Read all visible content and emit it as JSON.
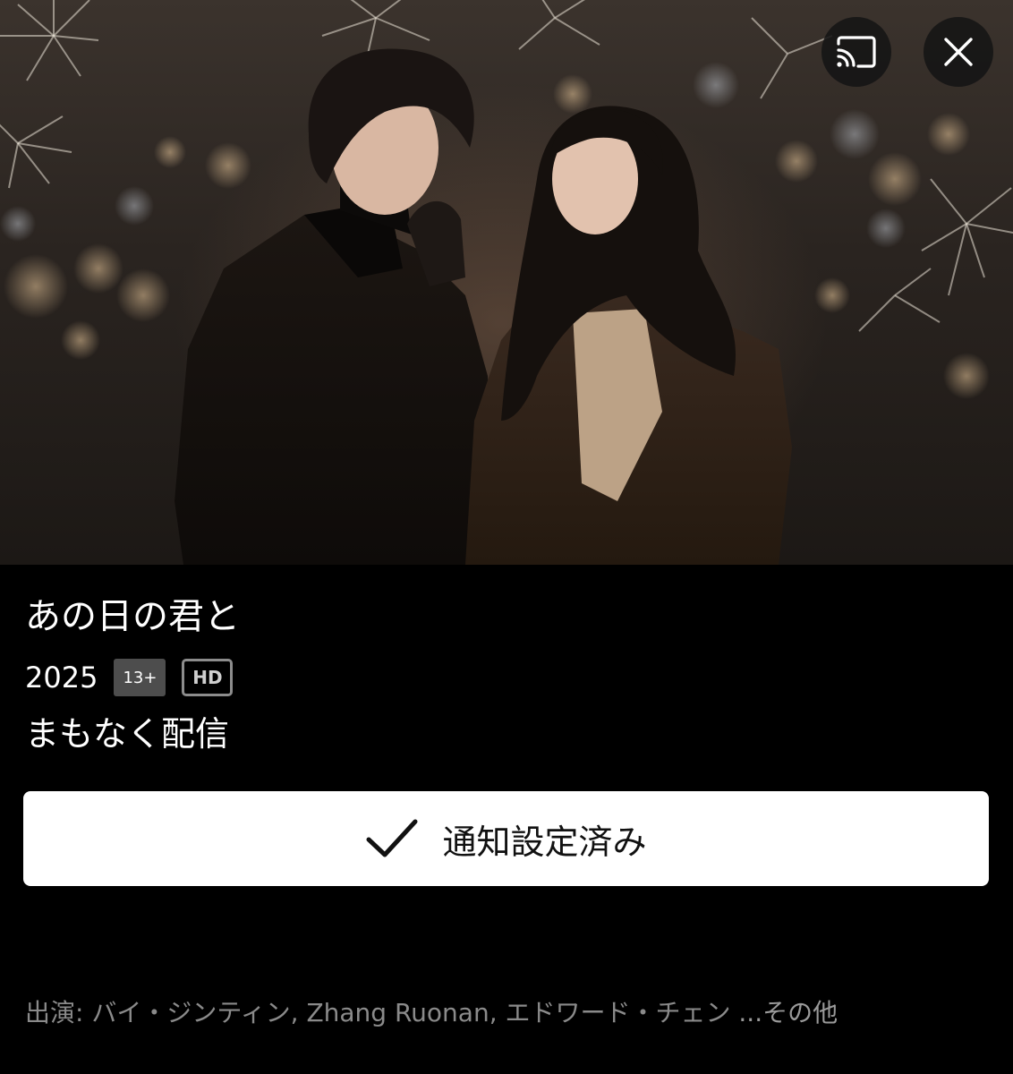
{
  "hero": {
    "image_alt": "poster-couple-fireworks-night"
  },
  "controls": {
    "cast_icon": "cast-icon",
    "close_icon": "close-icon"
  },
  "title": "あの日の君と",
  "meta": {
    "year": "2025",
    "rating": "13+",
    "quality": "HD"
  },
  "availability": "まもなく配信",
  "notify_button": {
    "label": "通知設定済み",
    "icon": "check-icon"
  },
  "cast": {
    "prefix": "出演: ",
    "names": "バイ・ジンティン, Zhang Ruonan, エドワード・チェン",
    "more": " ...その他"
  },
  "colors": {
    "background": "#000000",
    "button_bg": "#ffffff",
    "rating_badge": "#4d4d4d",
    "muted_text": "#8a8a8a"
  }
}
